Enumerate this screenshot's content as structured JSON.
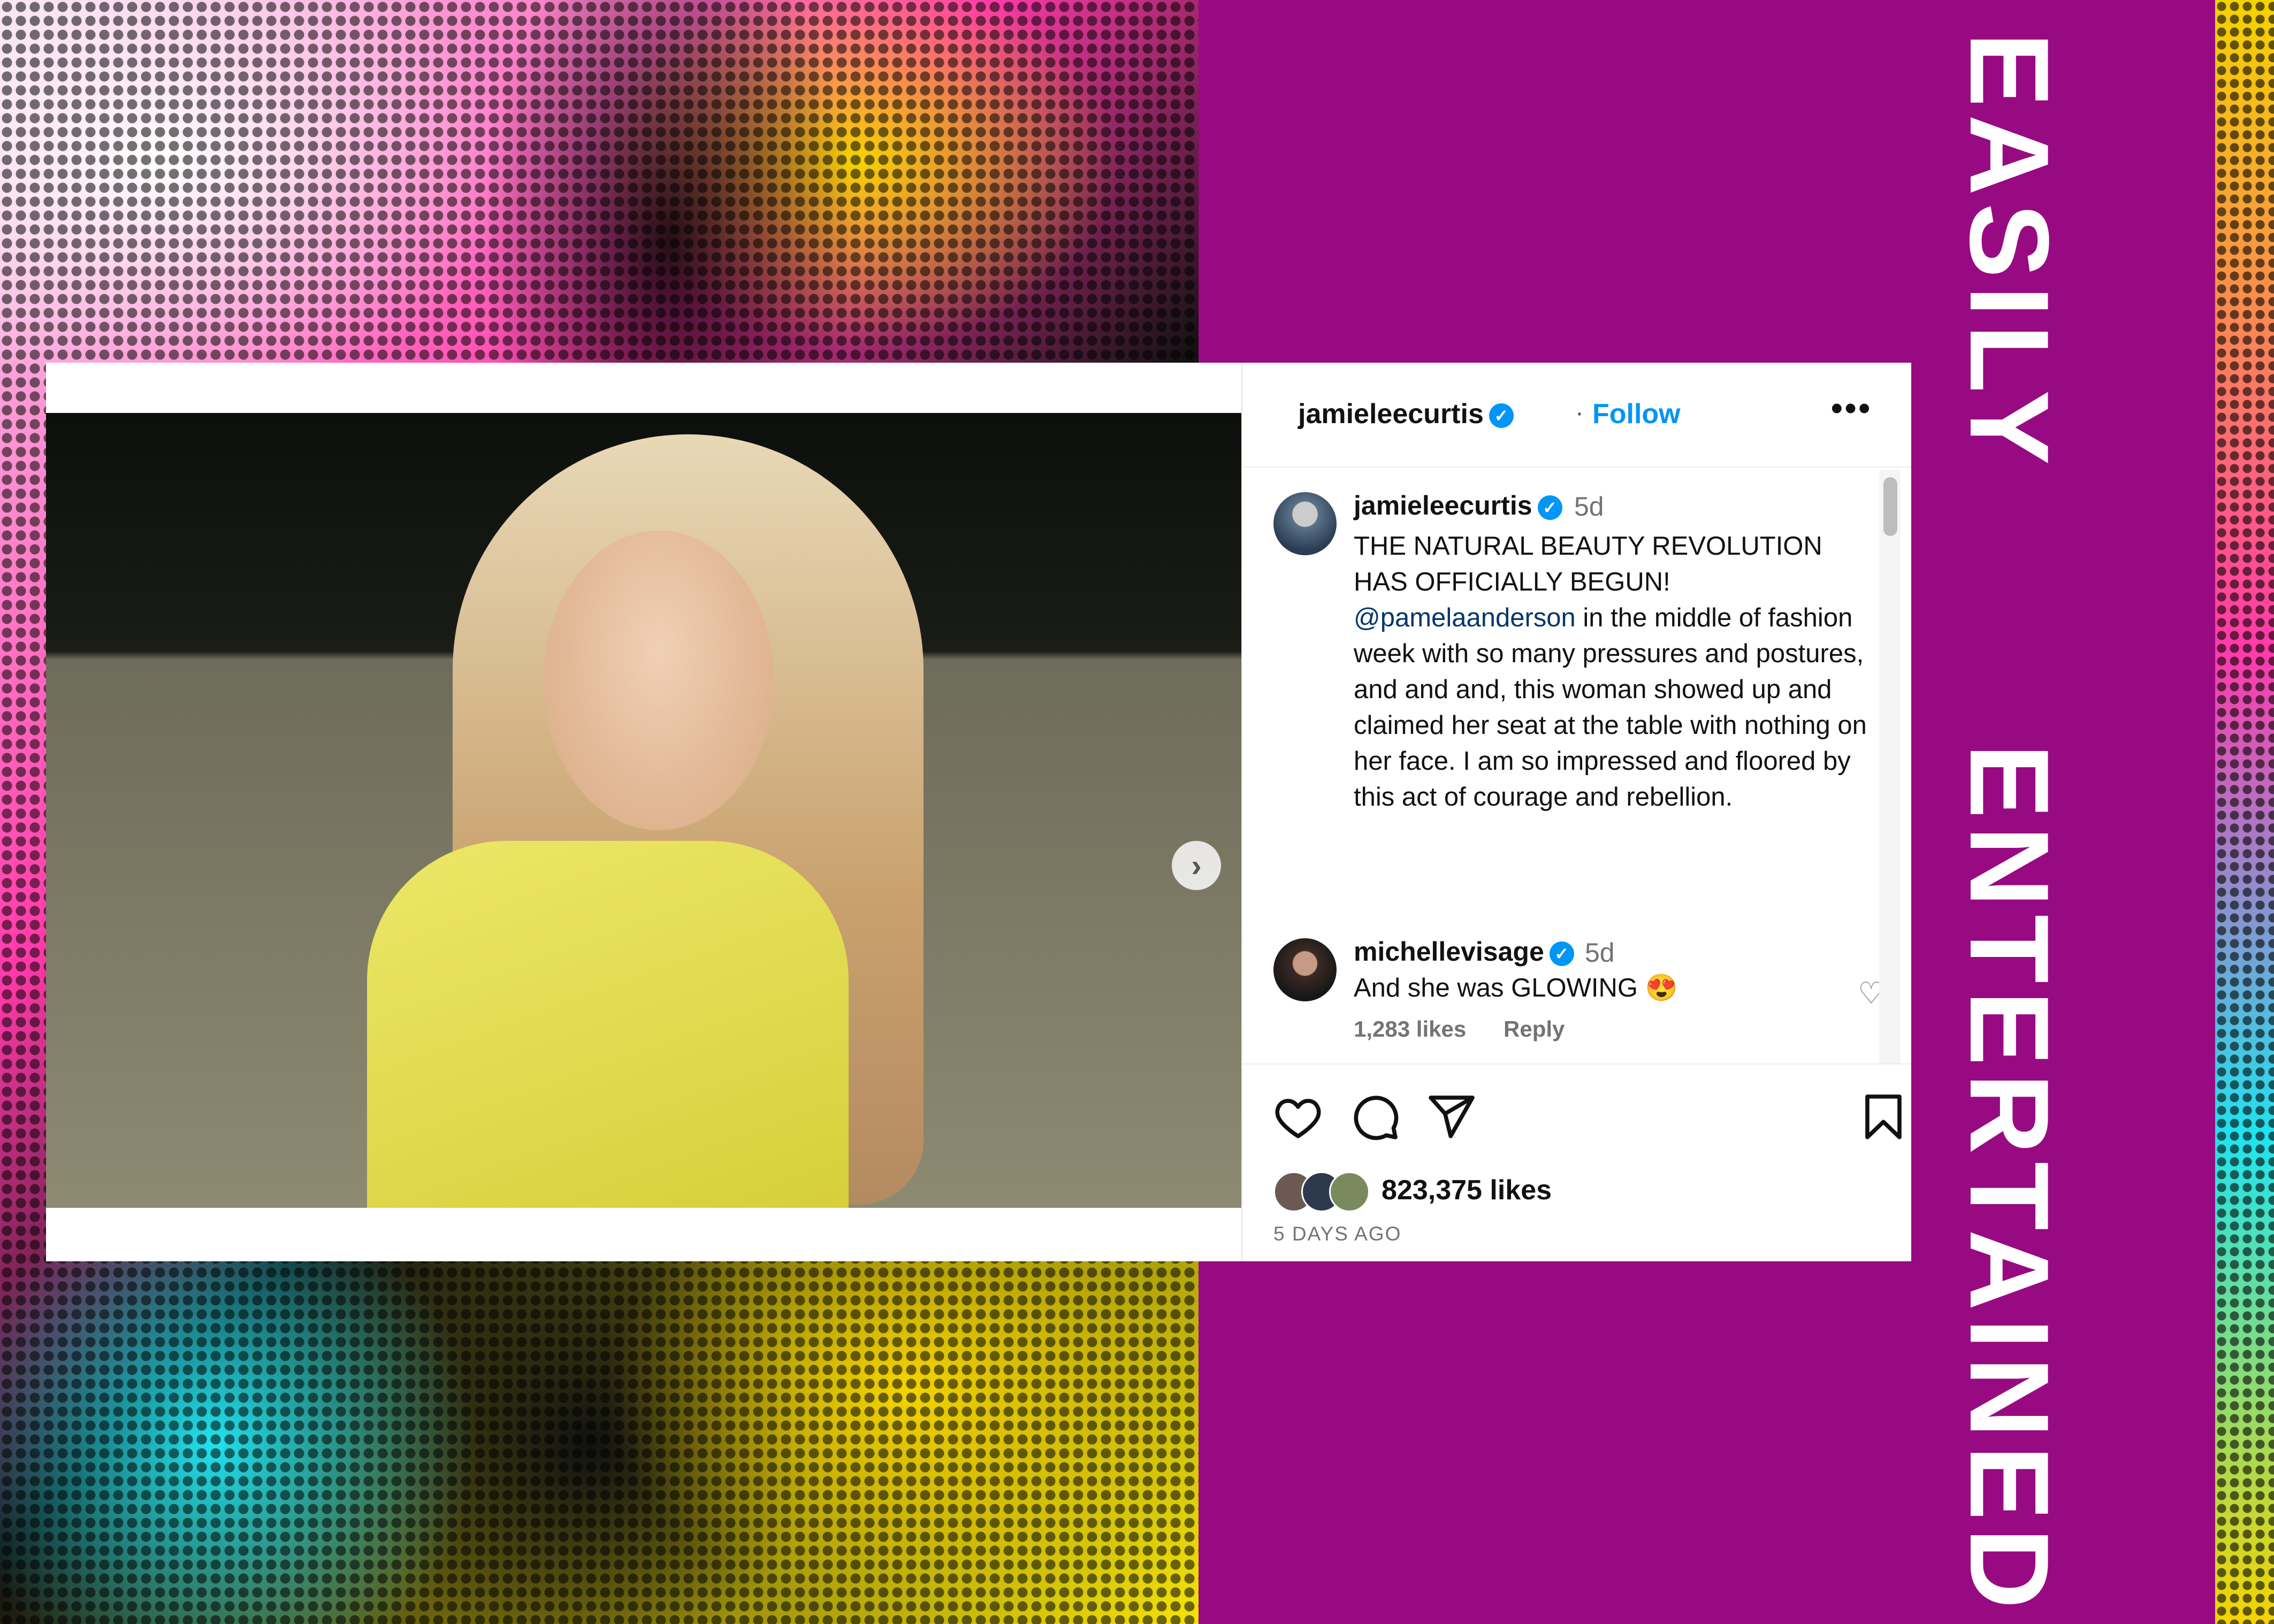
{
  "headline": {
    "word1": "EASILY",
    "word2": "ENTERTAINED"
  },
  "post": {
    "header": {
      "username": "jamieleecurtis",
      "separator": "·",
      "follow_label": "Follow",
      "more_label": "•••"
    },
    "caption": {
      "username": "jamieleecurtis",
      "time": "5d",
      "text_part1": "THE NATURAL BEAUTY REVOLUTION HAS OFFICIALLY BEGUN! ",
      "mention": "@pamelaanderson",
      "text_part2": " in the middle of fashion week with so many pressures and postures, and and and, this woman showed up and claimed her seat at the table with nothing on her face. I am so impressed and floored by this act of courage and rebellion."
    },
    "comment": {
      "username": "michellevisage",
      "time": "5d",
      "text": "And she was GLOWING 😍",
      "likes": "1,283 likes",
      "reply_label": "Reply"
    },
    "likes_count": "823,375 likes",
    "age": "5 DAYS AGO",
    "carousel": {
      "total": 2,
      "current": 1
    },
    "colors": {
      "accent": "#0095f6",
      "panel": "#980a82"
    }
  }
}
